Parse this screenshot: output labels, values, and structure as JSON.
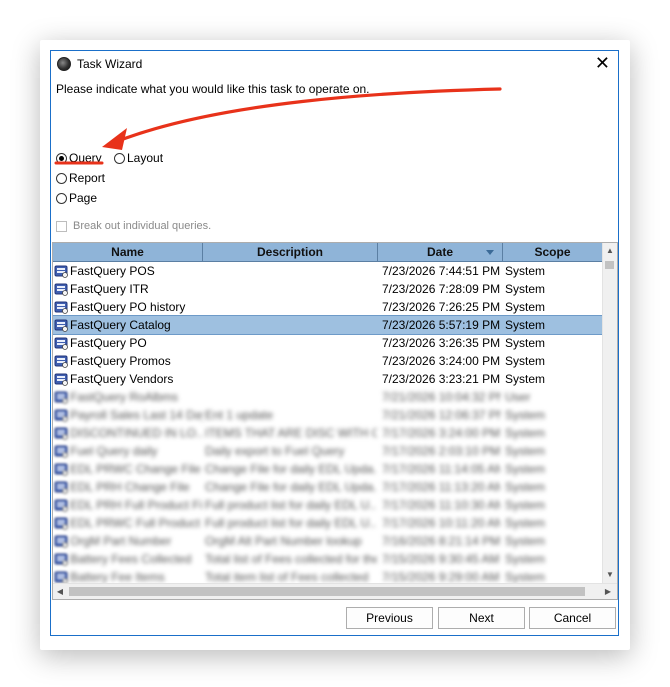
{
  "window": {
    "title": "Task Wizard",
    "close_symbol": "✕"
  },
  "prompt": "Please indicate what you would like this task to operate on.",
  "options": [
    {
      "label": "Query",
      "selected": true
    },
    {
      "label": "Layout",
      "selected": false
    },
    {
      "label": "Report",
      "selected": false
    },
    {
      "label": "Page",
      "selected": false
    }
  ],
  "checkbox": {
    "label": "Break out individual queries.",
    "checked": false,
    "enabled": false
  },
  "table": {
    "columns": [
      "Name",
      "Description",
      "Date",
      "Scope"
    ],
    "sorted_column": "Date",
    "rows": [
      {
        "name": "FastQuery POS",
        "description": "",
        "date": "7/23/2026 7:44:51 PM",
        "scope": "System"
      },
      {
        "name": "FastQuery ITR",
        "description": "",
        "date": "7/23/2026 7:28:09 PM",
        "scope": "System"
      },
      {
        "name": "FastQuery PO history",
        "description": "",
        "date": "7/23/2026 7:26:25 PM",
        "scope": "System"
      },
      {
        "name": "FastQuery Catalog",
        "description": "",
        "date": "7/23/2026 5:57:19 PM",
        "scope": "System",
        "selected": true
      },
      {
        "name": "FastQuery PO",
        "description": "",
        "date": "7/23/2026 3:26:35 PM",
        "scope": "System"
      },
      {
        "name": "FastQuery Promos",
        "description": "",
        "date": "7/23/2026 3:24:00 PM",
        "scope": "System"
      },
      {
        "name": "FastQuery Vendors",
        "description": "",
        "date": "7/23/2026 3:23:21 PM",
        "scope": "System"
      },
      {
        "name": "FastQuery RoAlbms",
        "description": "",
        "date": "7/21/2026 10:04:32 PM",
        "scope": "User",
        "blurred": true
      },
      {
        "name": "Payroll Sales Last 14 Days",
        "description": "Ent 1 update",
        "date": "7/21/2026 12:06:37 PM",
        "scope": "System",
        "blurred": true
      },
      {
        "name": "DISCONTINUED IN LO...",
        "description": "ITEMS THAT ARE DISC WITH O...",
        "date": "7/17/2026 3:24:00 PM",
        "scope": "System",
        "blurred": true
      },
      {
        "name": "Fuel Query daily",
        "description": "Daily export to Fuel Query",
        "date": "7/17/2026 2:03:10 PM",
        "scope": "System",
        "blurred": true
      },
      {
        "name": "EDL PRWC Change File",
        "description": "Change File for daily EDL Upda...",
        "date": "7/17/2026 11:14:05 AM",
        "scope": "System",
        "blurred": true
      },
      {
        "name": "EDL PRH Change File",
        "description": "Change File for daily EDL Upda...",
        "date": "7/17/2026 11:13:20 AM",
        "scope": "System",
        "blurred": true
      },
      {
        "name": "EDL PRH Full Product File",
        "description": "Full product list for daily EDL U...",
        "date": "7/17/2026 11:10:30 AM",
        "scope": "System",
        "blurred": true
      },
      {
        "name": "EDL PRWC Full Product F...",
        "description": "Full product list for daily EDL U...",
        "date": "7/17/2026 10:11:20 AM",
        "scope": "System",
        "blurred": true
      },
      {
        "name": "OrgM Part Number",
        "description": "OrgM Alt Part Number lookup",
        "date": "7/16/2026 8:21:14 PM",
        "scope": "System",
        "blurred": true
      },
      {
        "name": "Battery Fees Collected",
        "description": "Total list of Fees collected for the ...",
        "date": "7/15/2026 9:30:45 AM",
        "scope": "System",
        "blurred": true
      },
      {
        "name": "Battery Fee Items",
        "description": "Total item list of Fees collected",
        "date": "7/15/2026 9:29:00 AM",
        "scope": "System",
        "blurred": true
      }
    ]
  },
  "buttons": {
    "previous": "Previous",
    "next": "Next",
    "cancel": "Cancel"
  },
  "scroll_arrows": {
    "up": "▲",
    "down": "▼",
    "left": "◀",
    "right": "▶"
  },
  "colors": {
    "accent_border": "#1a6fc9",
    "header_bg": "#8fb4d8",
    "selected_row": "#9ec0e0",
    "annotation": "#e8321a"
  }
}
